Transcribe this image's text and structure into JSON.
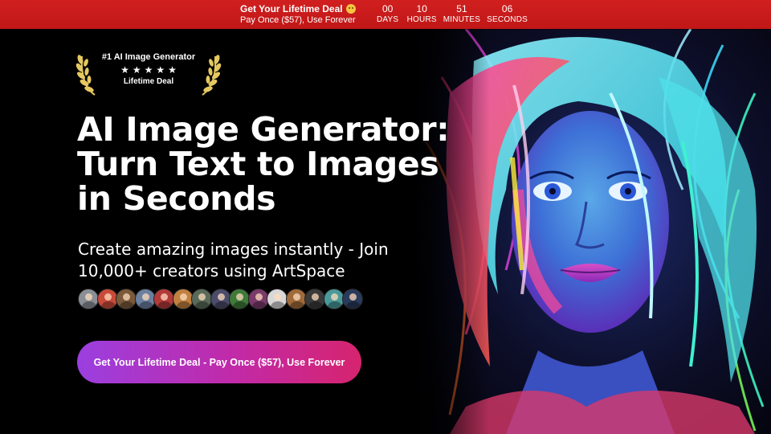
{
  "promo_bar": {
    "title": "Get Your Lifetime Deal",
    "emoji_icon": "smiling-face-icon",
    "subtitle": "Pay Once ($57), Use Forever",
    "background": "#c91c1c",
    "countdown": [
      {
        "value": "00",
        "label": "DAYS"
      },
      {
        "value": "10",
        "label": "HOURS"
      },
      {
        "value": "51",
        "label": "MINUTES"
      },
      {
        "value": "06",
        "label": "SECONDS"
      }
    ]
  },
  "badge": {
    "title": "#1 AI Image Generator",
    "stars": [
      "★",
      "★",
      "★",
      "★",
      "★"
    ],
    "subtitle": "Lifetime Deal",
    "laurel_color": "#e5c860"
  },
  "hero": {
    "headline_lines": [
      "AI Image Generator:",
      "Turn Text to Images",
      "in Seconds"
    ],
    "subheadline_lines": [
      "Create amazing images instantly - Join",
      "10,000+ creators using ArtSpace"
    ],
    "avatar_colors": [
      "#8a8f96",
      "#c94a3a",
      "#7a5a3a",
      "#6b7fa0",
      "#b33a3a",
      "#c08040",
      "#5a6a5a",
      "#4b4b6b",
      "#3f7a3a",
      "#7a3a6a",
      "#d8d8d8",
      "#a06a3a",
      "#3a3a3a",
      "#4a9a9a",
      "#2a3a5a"
    ],
    "image_alt": "neon portrait of a woman with colorful hair"
  },
  "cta": {
    "label": "Get Your Lifetime Deal - Pay Once ($57), Use Forever",
    "gradient_start": "#9b3fe0",
    "gradient_end": "#d6246e"
  }
}
